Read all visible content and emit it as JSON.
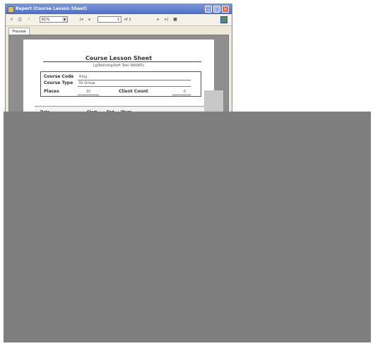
{
  "window": {
    "title": "Report (Course Lesson Sheet)",
    "controls": [
      "minimize-icon",
      "maximize-icon",
      "close-icon"
    ]
  },
  "toolbar": {
    "zoom": "61%",
    "page_current": "1",
    "page_of": "of 1"
  },
  "tabs": [
    {
      "label": "Preview"
    }
  ],
  "report": {
    "title": "Course Lesson Sheet",
    "subtitle": "Lg/Beilving/Soft Test (BA065)",
    "course_code_label": "Course Code",
    "course_code_value": "Ring",
    "course_type_label": "Course Type",
    "course_type_value": "Nr Group",
    "places_label": "Places",
    "places_value": "10",
    "client_count_label": "Client Count",
    "client_count_value": "0",
    "columns": [
      "Date",
      "Start",
      "End",
      "Wage"
    ]
  }
}
